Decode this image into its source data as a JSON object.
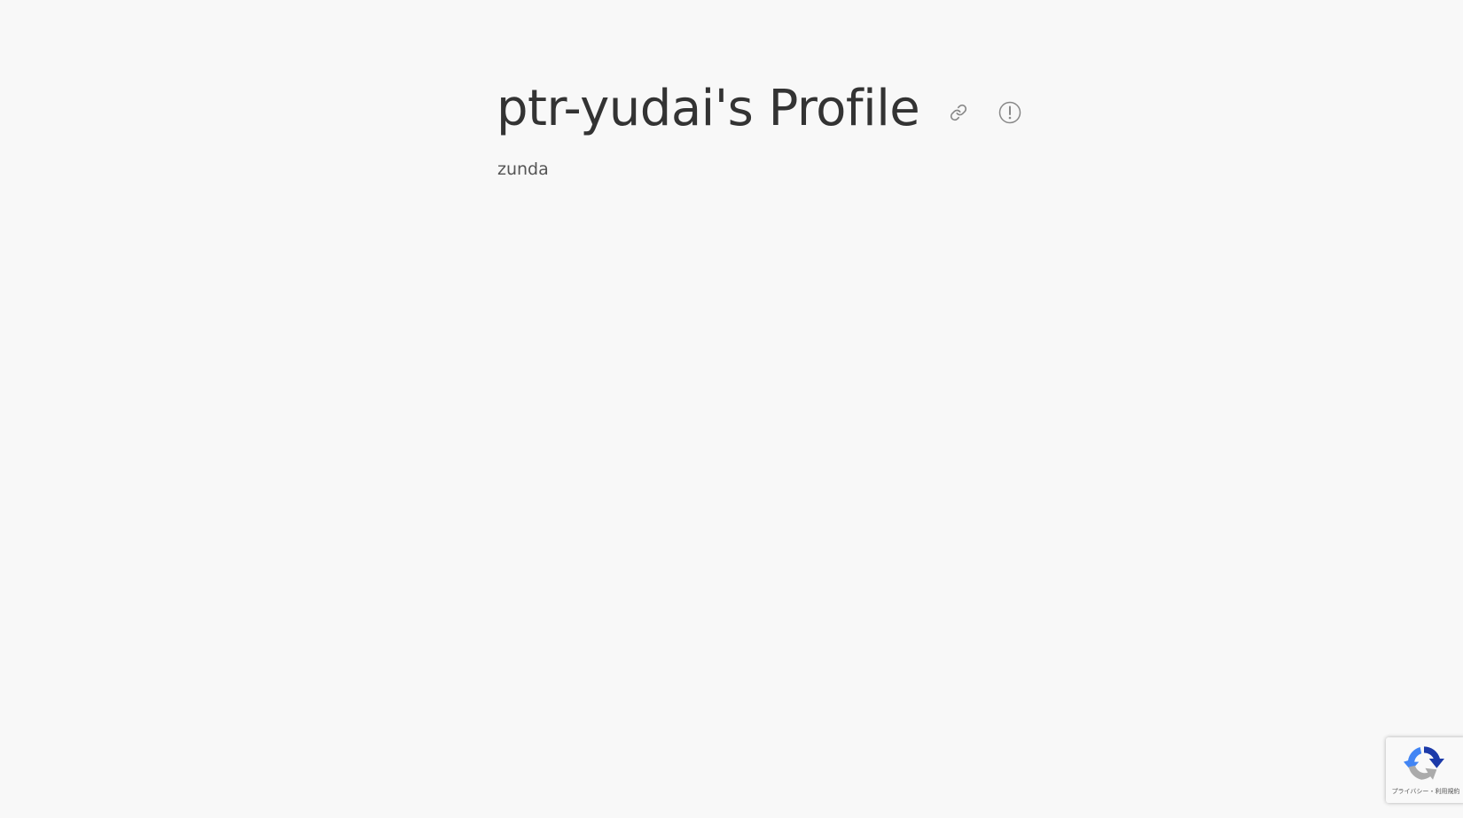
{
  "profile": {
    "title": "ptr-yudai's Profile",
    "subtitle": "zunda"
  },
  "actions": {
    "link_icon": "link-icon",
    "report_icon": "exclamation-circle-icon"
  },
  "recaptcha": {
    "privacy_label": "プライバシー",
    "separator": "・",
    "terms_label": "利用規約",
    "colors": {
      "blue": "#1c3aa9",
      "light_blue": "#4285f4",
      "gray": "#ababab"
    }
  },
  "colors": {
    "background": "#f8f8f8",
    "title": "#333333",
    "subtitle": "#555555",
    "icon": "#888888"
  }
}
